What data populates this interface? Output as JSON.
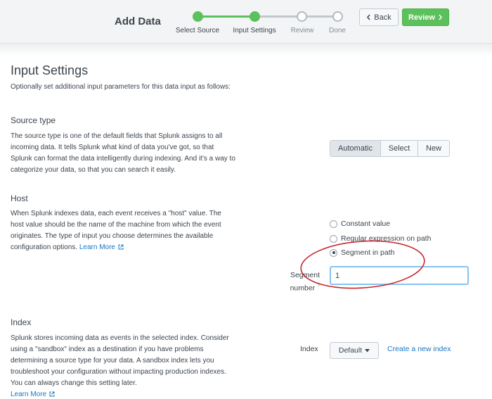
{
  "header": {
    "title": "Add Data",
    "steps": [
      {
        "label": "Select Source",
        "state": "done"
      },
      {
        "label": "Input Settings",
        "state": "current"
      },
      {
        "label": "Review",
        "state": "todo"
      },
      {
        "label": "Done",
        "state": "todo"
      }
    ],
    "back_label": "Back",
    "review_label": "Review",
    "back_icon": "chevron-left-icon",
    "review_icon": "chevron-right-icon"
  },
  "page": {
    "title": "Input Settings",
    "subtitle": "Optionally set additional input parameters for this data input as follows:"
  },
  "source_type": {
    "title": "Source type",
    "description": "The source type is one of the default fields that Splunk assigns to all incoming data. It tells Splunk what kind of data you've got, so that Splunk can format the data intelligently during indexing. And it's a way to categorize your data, so that you can search it easily.",
    "options": [
      "Automatic",
      "Select",
      "New"
    ],
    "selected": "Automatic"
  },
  "host": {
    "title": "Host",
    "description": "When Splunk indexes data, each event receives a \"host\" value. The host value should be the name of the machine from which the event originates. The type of input you choose determines the available configuration options.",
    "learn_more": "Learn More",
    "options": [
      "Constant value",
      "Regular expression on path",
      "Segment in path"
    ],
    "selected": "Segment in path",
    "segment_label": "Segment number",
    "segment_help": "?",
    "segment_value": "1"
  },
  "index": {
    "title": "Index",
    "description": "Splunk stores incoming data as events in the selected index. Consider using a \"sandbox\" index as a destination if you have problems determining a source type for your data. A sandbox index lets you troubleshoot your configuration without impacting production indexes. You can always change this setting later.",
    "learn_more": "Learn More",
    "field_label": "Index",
    "dropdown_value": "Default",
    "create_link": "Create a new index"
  },
  "colors": {
    "accent_green": "#5cc05c",
    "link_blue": "#1a76c2",
    "annotation_red": "#c8282d",
    "input_focus": "#87c3ef"
  }
}
